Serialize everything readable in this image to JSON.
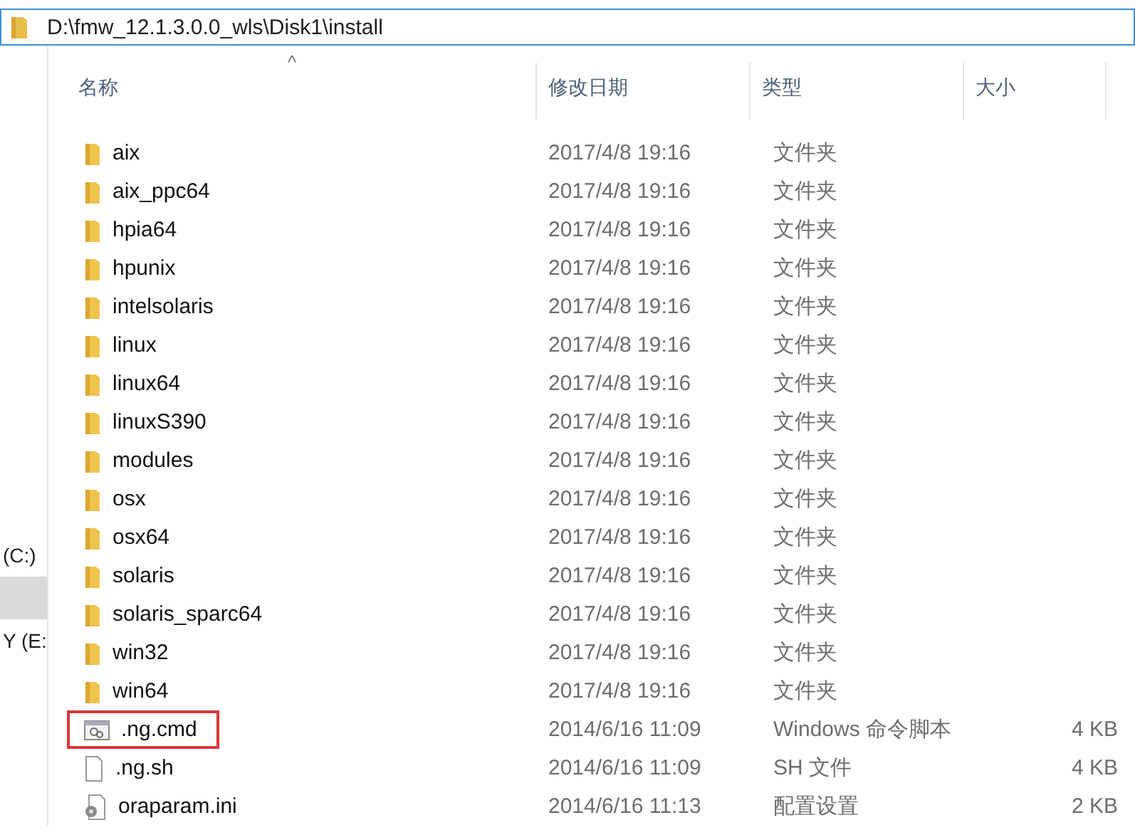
{
  "address_bar": {
    "path": "D:\\fmw_12.1.3.0.0_wls\\Disk1\\install"
  },
  "nav_items": [
    {
      "label": "(C:)",
      "selected": false
    },
    {
      "selected": true
    },
    {
      "label": "Y (E:",
      "selected": false
    }
  ],
  "table": {
    "sort_indicator": "^",
    "columns": [
      "名称",
      "修改日期",
      "类型",
      "大小"
    ],
    "rows": [
      {
        "kind": "folder",
        "name": "aix",
        "date": "2017/4/8 19:16",
        "type": "文件夹",
        "highlighted": false
      },
      {
        "kind": "folder",
        "name": "aix_ppc64",
        "date": "2017/4/8 19:16",
        "type": "文件夹",
        "highlighted": false
      },
      {
        "kind": "folder",
        "name": "hpia64",
        "date": "2017/4/8 19:16",
        "type": "文件夹",
        "highlighted": false
      },
      {
        "kind": "folder",
        "name": "hpunix",
        "date": "2017/4/8 19:16",
        "type": "文件夹",
        "highlighted": false
      },
      {
        "kind": "folder",
        "name": "intelsolaris",
        "date": "2017/4/8 19:16",
        "type": "文件夹",
        "highlighted": false
      },
      {
        "kind": "folder",
        "name": "linux",
        "date": "2017/4/8 19:16",
        "type": "文件夹",
        "highlighted": false
      },
      {
        "kind": "folder",
        "name": "linux64",
        "date": "2017/4/8 19:16",
        "type": "文件夹",
        "highlighted": false
      },
      {
        "kind": "folder",
        "name": "linuxS390",
        "date": "2017/4/8 19:16",
        "type": "文件夹",
        "highlighted": false
      },
      {
        "kind": "folder",
        "name": "modules",
        "date": "2017/4/8 19:16",
        "type": "文件夹",
        "highlighted": false
      },
      {
        "kind": "folder",
        "name": "osx",
        "date": "2017/4/8 19:16",
        "type": "文件夹",
        "highlighted": false
      },
      {
        "kind": "folder",
        "name": "osx64",
        "date": "2017/4/8 19:16",
        "type": "文件夹",
        "highlighted": false
      },
      {
        "kind": "folder",
        "name": "solaris",
        "date": "2017/4/8 19:16",
        "type": "文件夹",
        "highlighted": false
      },
      {
        "kind": "folder",
        "name": "solaris_sparc64",
        "date": "2017/4/8 19:16",
        "type": "文件夹",
        "highlighted": false
      },
      {
        "kind": "folder",
        "name": "win32",
        "date": "2017/4/8 19:16",
        "type": "文件夹",
        "highlighted": false
      },
      {
        "kind": "folder",
        "name": "win64",
        "date": "2017/4/8 19:16",
        "type": "文件夹",
        "highlighted": false
      },
      {
        "kind": "script",
        "name": ".ng.cmd",
        "date": "2014/6/16 11:09",
        "type": "Windows 命令脚本",
        "size": "4 KB",
        "highlighted": true
      },
      {
        "kind": "file",
        "name": ".ng.sh",
        "date": "2014/6/16 11:09",
        "type": "SH 文件",
        "size": "4 KB",
        "highlighted": false
      },
      {
        "kind": "settings",
        "name": "oraparam.ini",
        "date": "2014/6/16 11:13",
        "type": "配置设置",
        "size": "2 KB",
        "highlighted": false
      }
    ]
  }
}
